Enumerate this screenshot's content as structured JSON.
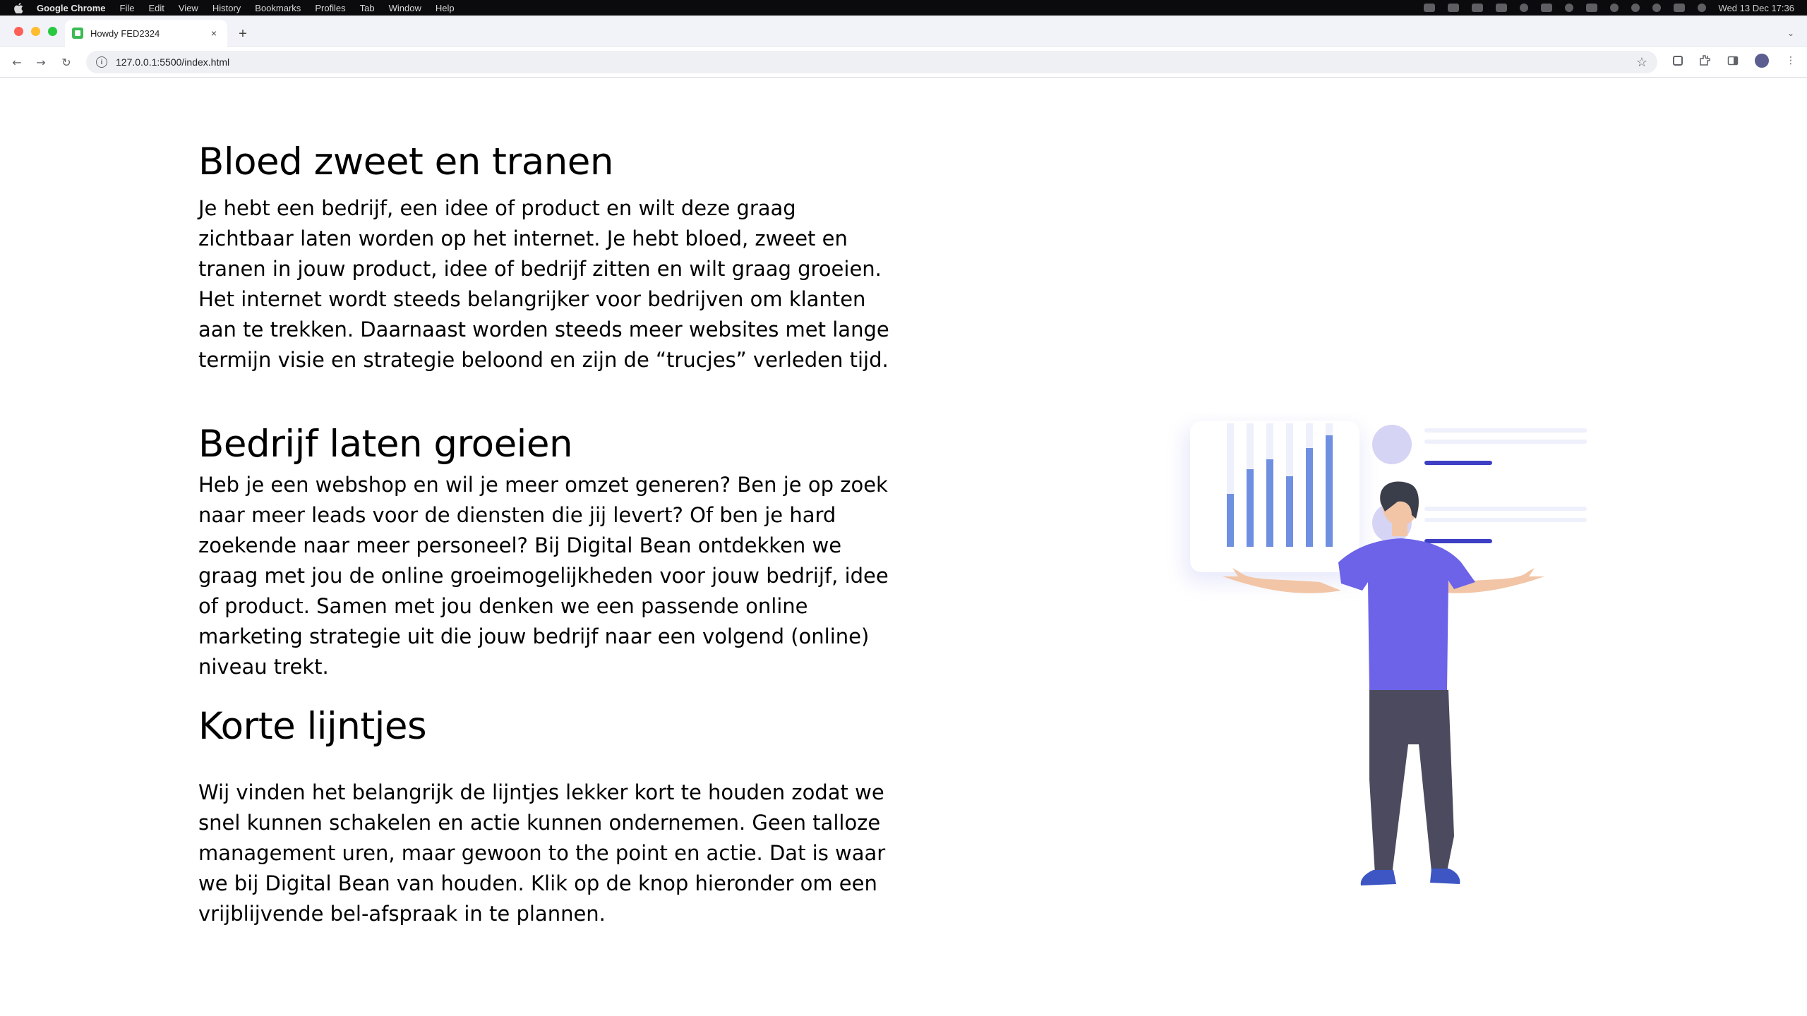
{
  "menubar": {
    "app_name": "Google Chrome",
    "items": [
      "File",
      "Edit",
      "View",
      "History",
      "Bookmarks",
      "Profiles",
      "Tab",
      "Window",
      "Help"
    ],
    "clock": "Wed 13 Dec  17:36"
  },
  "tab": {
    "title": "Howdy FED2324",
    "close_glyph": "×",
    "new_tab_glyph": "+"
  },
  "toolbar": {
    "url": "127.0.0.1:5500/index.html",
    "back_glyph": "←",
    "forward_glyph": "→",
    "reload_glyph": "↻",
    "bookmark_glyph": "☆"
  },
  "sections": [
    {
      "heading": "Bloed zweet en tranen",
      "body": "Je hebt een bedrijf, een idee of product en wilt deze graag zichtbaar laten worden op het internet. Je hebt bloed, zweet en tranen in jouw product, idee of bedrijf zitten en wilt graag groeien. Het internet wordt steeds belangrijker voor bedrijven om klanten aan te trekken. Daarnaast worden steeds meer websites met lange termijn visie en strategie beloond en zijn de “trucjes” verleden tijd."
    },
    {
      "heading": "Bedrijf laten groeien",
      "body": "Heb je een webshop en wil je meer omzet generen? Ben je op zoek naar meer leads voor de diensten die jij levert? Of ben je hard zoekende naar meer personeel? Bij Digital Bean ontdekken we graag met jou de online groeimogelijkheden voor jouw bedrijf, idee of product. Samen met jou denken we een passende online marketing strategie uit die jouw bedrijf naar een volgend (online) niveau trekt."
    },
    {
      "heading": "Korte lijntjes",
      "body": "Wij vinden het belangrijk de lijntjes lekker kort te houden zodat we snel kunnen schakelen en actie kunnen ondernemen. Geen talloze management uren, maar gewoon to the point en actie. Dat is waar we bij Digital Bean van houden. Klik op de knop hieronder om een vrijblijvende bel-afspraak in te plannen."
    }
  ],
  "illustration": {
    "icon": "person-presenting-dashboard-illustration",
    "colors": {
      "shirt": "#6c63e8",
      "pants": "#4b4a5e",
      "hair": "#3a3d4a",
      "skin": "#f2c5a6",
      "bars": "#6f8fe0",
      "accent": "#3d3fc4",
      "circle": "#d6d4f5"
    }
  }
}
